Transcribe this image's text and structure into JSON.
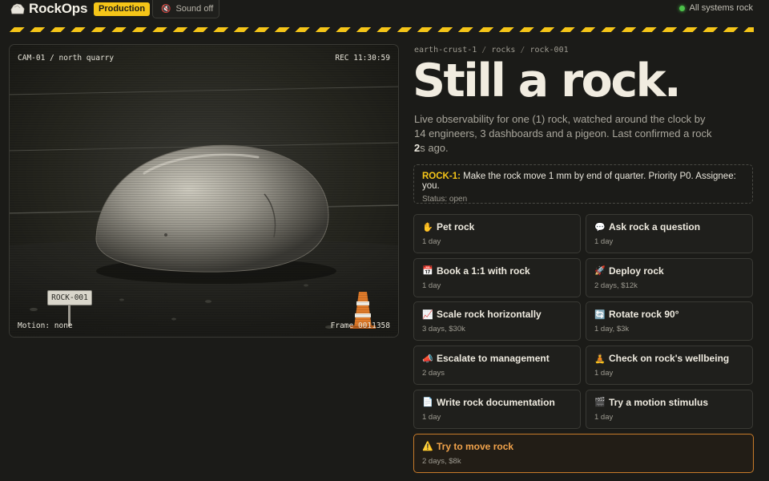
{
  "app": {
    "name": "RockOps",
    "environment": "Production",
    "sound_label": "Sound off",
    "status_text": "All systems rock",
    "icons": {
      "logo": "rock-logo-icon",
      "sound": "mute-icon",
      "status": "green-status-dot"
    },
    "colors": {
      "accent": "#f5c518",
      "status_ok": "#4cc24a",
      "danger": "#f0a24b"
    }
  },
  "camera": {
    "label": "CAM-01 / north quarry",
    "rec": "REC 11:30:59",
    "motion": "Motion: none",
    "frame": "Frame 0011358",
    "sign": "ROCK-001"
  },
  "breadcrumb": [
    "earth-crust-1",
    "rocks",
    "rock-001"
  ],
  "headline": "Still a rock.",
  "description": {
    "before": "Live observability for one (1) rock, watched around the clock by 14 engineers, 3 dashboards and a pigeon. Last confirmed a rock ",
    "seconds": "2",
    "after": "s ago."
  },
  "ticket": {
    "id": "ROCK-1:",
    "text": " Make the rock move 1 mm by end of quarter. Priority P0. Assignee: you.",
    "status": "Status: open"
  },
  "actions": [
    {
      "label": "Pet rock",
      "meta": "1 day",
      "icon": "hand-icon",
      "glyph": "✋"
    },
    {
      "label": "Ask rock a question",
      "meta": "1 day",
      "icon": "speech-bubble-icon",
      "glyph": "💬"
    },
    {
      "label": "Book a 1:1 with rock",
      "meta": "1 day",
      "icon": "calendar-icon",
      "glyph": "📅"
    },
    {
      "label": "Deploy rock",
      "meta": "2 days, $12k",
      "icon": "rocket-icon",
      "glyph": "🚀"
    },
    {
      "label": "Scale rock horizontally",
      "meta": "3 days, $30k",
      "icon": "chart-up-icon",
      "glyph": "📈"
    },
    {
      "label": "Rotate rock 90°",
      "meta": "1 day, $3k",
      "icon": "rotate-icon",
      "glyph": "🔄"
    },
    {
      "label": "Escalate to management",
      "meta": "2 days",
      "icon": "megaphone-icon",
      "glyph": "📣"
    },
    {
      "label": "Check on rock's wellbeing",
      "meta": "1 day",
      "icon": "meditation-icon",
      "glyph": "🧘"
    },
    {
      "label": "Write rock documentation",
      "meta": "1 day",
      "icon": "document-icon",
      "glyph": "📄"
    },
    {
      "label": "Try a motion stimulus",
      "meta": "1 day",
      "icon": "clapperboard-icon",
      "glyph": "🎬"
    }
  ],
  "primary_action": {
    "label": "Try to move rock",
    "meta": "2 days, $8k",
    "icon": "warning-icon",
    "glyph": "⚠️"
  }
}
